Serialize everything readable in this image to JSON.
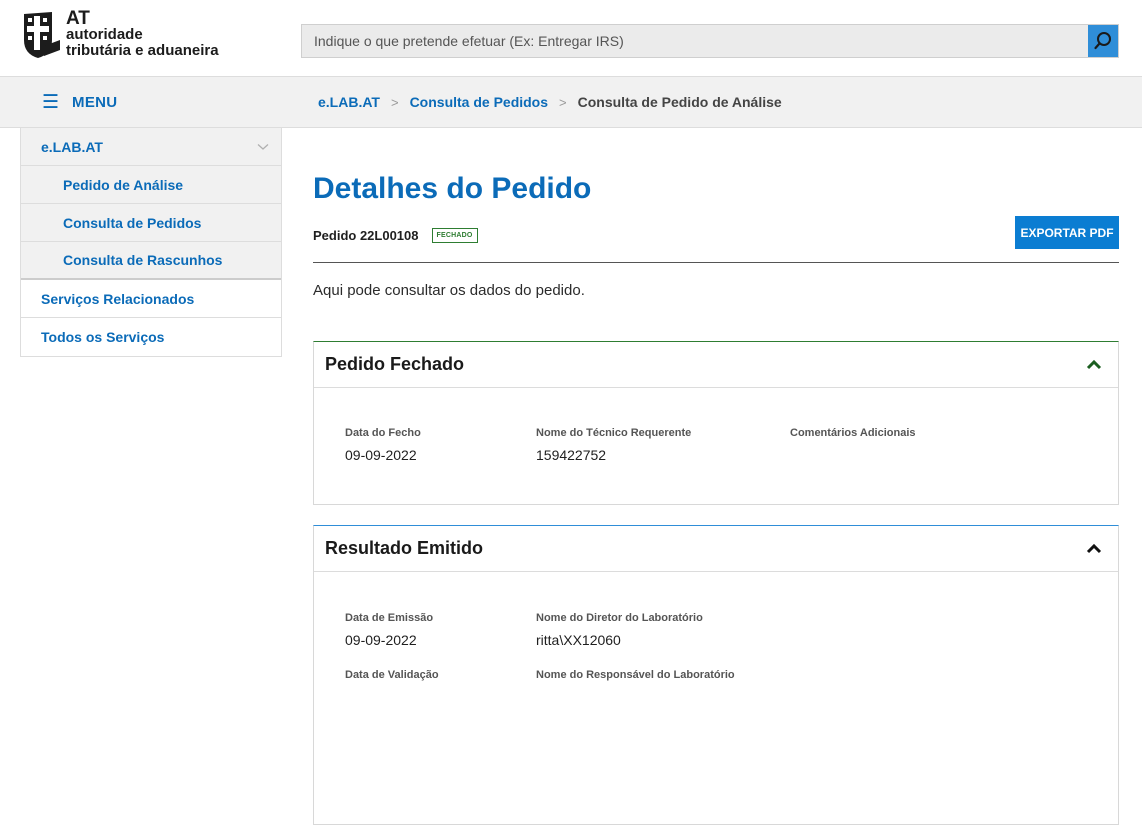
{
  "header": {
    "logo": {
      "line1": "AT",
      "line2": "autoridade",
      "line3": "tributária e aduaneira"
    },
    "search": {
      "placeholder": "Indique o que pretende efetuar (Ex: Entregar IRS)",
      "value": ""
    },
    "icons": {
      "search": "search-icon",
      "menu": "hamburger-icon"
    },
    "colors": {
      "accent": "#0b6bb8",
      "search_button": "#2f8ed8",
      "closed_status": "#2e7d32"
    }
  },
  "menu": {
    "label": "MENU"
  },
  "breadcrumb": {
    "items": [
      "e.LAB.AT",
      "Consulta de Pedidos"
    ],
    "current": "Consulta de Pedido de Análise",
    "separator": ">"
  },
  "sidebar": {
    "section": "e.LAB.AT",
    "subitems": [
      "Pedido de Análise",
      "Consulta de Pedidos",
      "Consulta de Rascunhos"
    ],
    "items": [
      "Serviços Relacionados",
      "Todos os Serviços"
    ]
  },
  "main": {
    "title": "Detalhes do Pedido",
    "pedido_label": "Pedido 22L00108",
    "status_badge": "FECHADO",
    "export_button": "EXPORTAR PDF",
    "intro": "Aqui pode consultar os dados do pedido."
  },
  "cards": [
    {
      "title": "Pedido Fechado",
      "fields": [
        {
          "label": "Data do Fecho",
          "value": "09-09-2022"
        },
        {
          "label": "Nome do Técnico Requerente",
          "value": "159422752"
        },
        {
          "label": "Comentários Adicionais",
          "value": ""
        }
      ]
    },
    {
      "title": "Resultado Emitido",
      "fields": [
        {
          "label": "Data de Emissão",
          "value": "09-09-2022"
        },
        {
          "label": "Nome do Diretor do Laboratório",
          "value": "ritta\\XX12060"
        },
        {
          "label": "Data de Validação",
          "value": ""
        },
        {
          "label": "Nome do Responsável do Laboratório",
          "value": ""
        }
      ]
    }
  ]
}
